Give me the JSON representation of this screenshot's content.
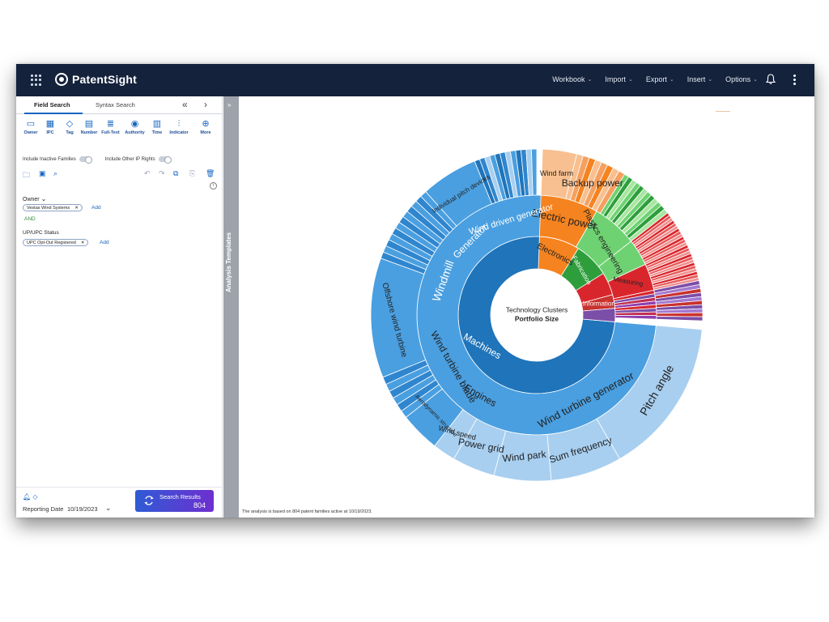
{
  "app": {
    "name": "PatentSight"
  },
  "menu": {
    "items": [
      "Workbook",
      "Import",
      "Export",
      "Insert",
      "Options"
    ]
  },
  "left_panel": {
    "tabs": {
      "field": "Field Search",
      "syntax": "Syntax Search"
    },
    "tools": [
      {
        "label": "Owner",
        "icon": "owner-icon"
      },
      {
        "label": "IPC",
        "icon": "ipc-icon"
      },
      {
        "label": "Tag",
        "icon": "tag-icon"
      },
      {
        "label": "Number",
        "icon": "number-icon"
      },
      {
        "label": "Full-Text",
        "icon": "full-text-icon"
      },
      {
        "label": "Authority",
        "icon": "authority-icon"
      },
      {
        "label": "Time",
        "icon": "time-icon"
      },
      {
        "label": "Indicator",
        "icon": "indicator-icon"
      },
      {
        "label": "More",
        "icon": "more-icon"
      }
    ],
    "toggle_inactive": "Include Inactive Families",
    "toggle_ip": "Include Other IP Rights",
    "owner_label": "Owner",
    "owner_chip": "Vestas Wind Systems",
    "add_label": "Add",
    "and_label": "AND",
    "status_label": "UP/UPC Status",
    "status_chip": "UPC Opt-Out Registered",
    "reporting_label": "Reporting Date",
    "reporting_date": "10/19/2023",
    "search_results_label": "Search Results",
    "search_results_value": "804"
  },
  "rail": {
    "label": "Analysis Templates"
  },
  "footnote": "The analysis is based on 804 patent families active at 10/19/2023.",
  "chart_data": {
    "type": "sunburst",
    "center_title": "Technology Clusters",
    "center_subtitle": "Portfolio Size",
    "colors": {
      "machines": "#1f74ba",
      "engines": "#4a9fe0",
      "engines_light": "#a8cff0",
      "electronics": "#f5831f",
      "electronics_light": "#f8c090",
      "fabrication": "#2e9e3c",
      "fabrication_light": "#6fd272",
      "measuring": "#d9262c",
      "information": "#c9322f",
      "purple": "#7b4ea8"
    },
    "inner": [
      {
        "label": "Machines",
        "value": 69
      },
      {
        "label": "Electronics",
        "value": 9
      },
      {
        "label": "Fabrication",
        "value": 6
      },
      {
        "label": "Measuring",
        "value": 3
      },
      {
        "label": "Information",
        "value": 3
      }
    ],
    "middle": [
      {
        "label": "Engines",
        "parent": "Machines"
      },
      {
        "label": "Electric power",
        "parent": "Electronics"
      },
      {
        "label": "Plastics engineering",
        "parent": "Fabrication"
      }
    ],
    "outer_labels": [
      "Pitch angle",
      "Wind turbine generator",
      "Sum frequency",
      "Wind park",
      "Power grid",
      "Wind speed",
      "Aerodynamic structure",
      "Wind turbine blade",
      "Windmill",
      "Offshore wind turbine",
      "Generator",
      "Wind driven generator",
      "Individual pitch devices",
      "Backup power",
      "Wind farm",
      "Electric power"
    ]
  }
}
